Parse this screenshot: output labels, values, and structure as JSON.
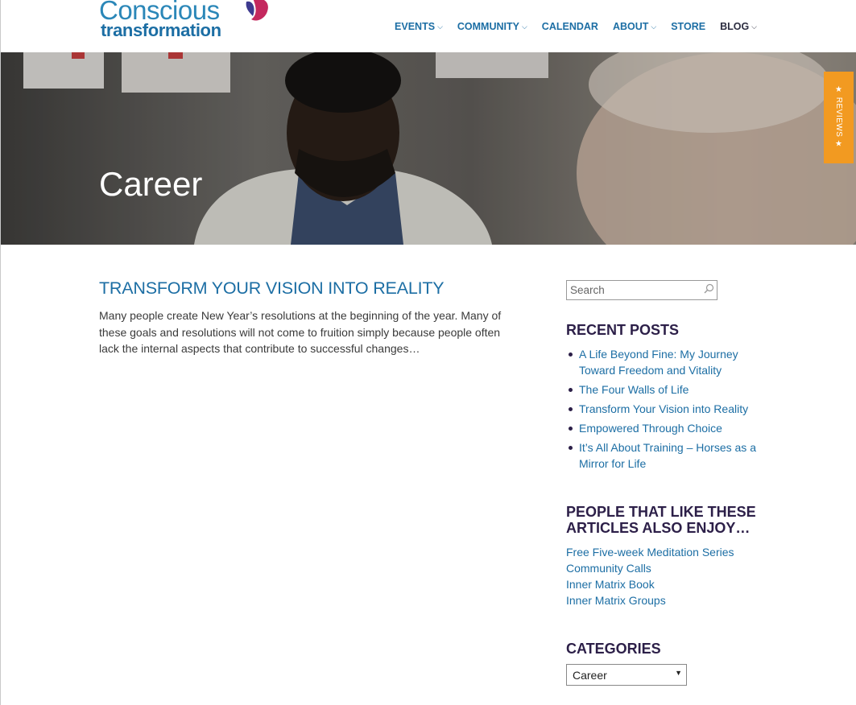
{
  "logo": {
    "line1": "Conscious",
    "line2": "transformation"
  },
  "nav": [
    {
      "label": "EVENTS",
      "dropdown": true
    },
    {
      "label": "COMMUNITY",
      "dropdown": true
    },
    {
      "label": "CALENDAR",
      "dropdown": false
    },
    {
      "label": "ABOUT",
      "dropdown": true
    },
    {
      "label": "STORE",
      "dropdown": false
    },
    {
      "label": "BLOG",
      "dropdown": true
    }
  ],
  "hero": {
    "title": "Career"
  },
  "reviews_tab": {
    "label": "★ REVIEWS ★"
  },
  "post": {
    "title": "TRANSFORM YOUR VISION INTO REALITY",
    "excerpt": "Many people create New Year’s resolutions at the beginning of the year. Many of these goals and resolutions will not come to fruition simply because people often lack the internal aspects that contribute to successful changes…"
  },
  "sidebar": {
    "search_placeholder": "Search",
    "recent_title": "RECENT POSTS",
    "recent_posts": [
      "A Life Beyond Fine: My Journey Toward Freedom and Vitality",
      "The Four Walls of Life",
      "Transform Your Vision into Reality",
      "Empowered Through Choice",
      "It’s All About Training – Horses as a Mirror for Life"
    ],
    "also_title": "PEOPLE THAT LIKE THESE ARTICLES ALSO ENJOY…",
    "also_links": [
      "Free Five-week Meditation Series",
      "Community Calls",
      "Inner Matrix Book",
      "Inner Matrix Groups"
    ],
    "categories_title": "CATEGORIES",
    "category_selected": "Career"
  },
  "colors": {
    "link_blue": "#1c6ea4",
    "heading_purple": "#2c1f48",
    "reviews_orange": "#f29a21"
  }
}
